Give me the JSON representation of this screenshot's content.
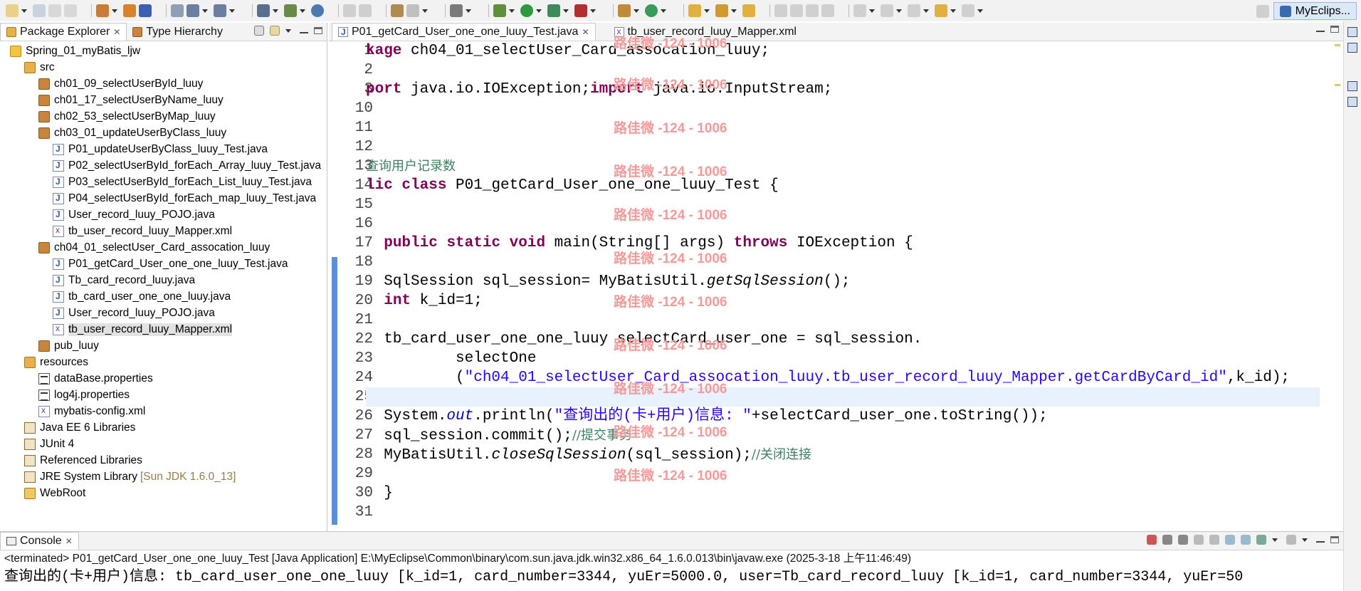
{
  "window": {
    "perspective": "MyEclips..."
  },
  "package_explorer": {
    "tabs": [
      {
        "label": "Package Explorer",
        "close": "✕"
      },
      {
        "label": "Type Hierarchy"
      }
    ],
    "tree": [
      {
        "label": "Spring_01_myBatis_ljw",
        "icon": "project-icon",
        "depth": 1
      },
      {
        "label": "src",
        "icon": "source-folder-icon",
        "depth": 2
      },
      {
        "label": "ch01_09_selectUserById_luuy",
        "icon": "package-icon",
        "depth": 3
      },
      {
        "label": "ch01_17_selectUserByName_luuy",
        "icon": "package-icon",
        "depth": 3
      },
      {
        "label": "ch02_53_selectUserByMap_luuy",
        "icon": "package-icon",
        "depth": 3
      },
      {
        "label": "ch03_01_updateUserByClass_luuy",
        "icon": "package-icon",
        "depth": 3
      },
      {
        "label": "P01_updateUserByClass_luuy_Test.java",
        "icon": "java-file-icon",
        "depth": 4
      },
      {
        "label": "P02_selectUserById_forEach_Array_luuy_Test.java",
        "icon": "java-file-icon",
        "depth": 4
      },
      {
        "label": "P03_selectUserById_forEach_List_luuy_Test.java",
        "icon": "java-file-icon",
        "depth": 4
      },
      {
        "label": "P04_selectUserById_forEach_map_luuy_Test.java",
        "icon": "java-file-icon",
        "depth": 4
      },
      {
        "label": "User_record_luuy_POJO.java",
        "icon": "java-file-icon",
        "depth": 4
      },
      {
        "label": "tb_user_record_luuy_Mapper.xml",
        "icon": "xml-file-icon",
        "depth": 4
      },
      {
        "label": "ch04_01_selectUser_Card_assocation_luuy",
        "icon": "package-icon",
        "depth": 3
      },
      {
        "label": "P01_getCard_User_one_one_luuy_Test.java",
        "icon": "java-file-icon",
        "depth": 4
      },
      {
        "label": "Tb_card_record_luuy.java",
        "icon": "java-file-icon",
        "depth": 4
      },
      {
        "label": "tb_card_user_one_one_luuy.java",
        "icon": "java-file-icon",
        "depth": 4
      },
      {
        "label": "User_record_luuy_POJO.java",
        "icon": "java-file-icon",
        "depth": 4
      },
      {
        "label": "tb_user_record_luuy_Mapper.xml",
        "icon": "xml-file-icon",
        "depth": 4,
        "selected": true
      },
      {
        "label": "pub_luuy",
        "icon": "package-icon",
        "depth": 3
      },
      {
        "label": "resources",
        "icon": "source-folder-icon",
        "depth": 2
      },
      {
        "label": "dataBase.properties",
        "icon": "properties-file-icon",
        "depth": 3
      },
      {
        "label": "log4j.properties",
        "icon": "properties-file-icon",
        "depth": 3
      },
      {
        "label": "mybatis-config.xml",
        "icon": "xml-file-icon",
        "depth": 3
      },
      {
        "label": "Java EE 6 Libraries",
        "icon": "library-icon",
        "depth": 2
      },
      {
        "label": "JUnit 4",
        "icon": "library-icon",
        "depth": 2
      },
      {
        "label": "Referenced Libraries",
        "icon": "library-icon",
        "depth": 2
      },
      {
        "label": "JRE System Library",
        "suffix": "[Sun JDK 1.6.0_13]",
        "icon": "library-icon",
        "depth": 2
      },
      {
        "label": "WebRoot",
        "icon": "folder-icon",
        "depth": 2
      }
    ]
  },
  "editor": {
    "tabs": [
      {
        "label": "P01_getCard_User_one_one_luuy_Test.java",
        "close": "✕",
        "active": true
      },
      {
        "label": "tb_user_record_luuy_Mapper.xml",
        "active": false
      }
    ],
    "line_numbers": [
      "1",
      "2",
      "3",
      "10",
      "11",
      "12",
      "13",
      "14",
      "15",
      "16",
      "17",
      "18",
      "19",
      "20",
      "21",
      "22",
      "23",
      "24",
      "25",
      "26",
      "27",
      "28",
      "29",
      "30",
      "31"
    ],
    "lines": [
      [
        {
          "t": "kage ",
          "c": "kw"
        },
        {
          "t": "ch04_01_selectUser_Card_assocation_luuy;"
        }
      ],
      [],
      [
        {
          "t": "port ",
          "c": "kw"
        },
        {
          "t": "java.io.IOException;"
        },
        {
          "t": "import ",
          "c": "kw"
        },
        {
          "t": "java.io.InputStream;"
        }
      ],
      [],
      [],
      [],
      [
        {
          "t": "查询用户记录数",
          "c": "cmt"
        }
      ],
      [
        {
          "t": "lic ",
          "c": "kw"
        },
        {
          "t": "class ",
          "c": "kw"
        },
        {
          "t": "P01_getCard_User_one_one_luuy_Test {"
        }
      ],
      [],
      [],
      [
        {
          "t": "  "
        },
        {
          "t": "public ",
          "c": "kw"
        },
        {
          "t": "static ",
          "c": "kw"
        },
        {
          "t": "void ",
          "c": "kw"
        },
        {
          "t": "main(String[] args) "
        },
        {
          "t": "throws ",
          "c": "kw"
        },
        {
          "t": "IOException {"
        }
      ],
      [],
      [
        {
          "t": "  SqlSession sql_session= MyBatisUtil."
        },
        {
          "t": "getSqlSession",
          "c": "it"
        },
        {
          "t": "();"
        }
      ],
      [
        {
          "t": "  "
        },
        {
          "t": "int ",
          "c": "kw"
        },
        {
          "t": "k_id=1;"
        }
      ],
      [],
      [
        {
          "t": "  tb_card_user_one_one_luuy selectCard_user_one = sql_session."
        }
      ],
      [
        {
          "t": "          selectOne"
        }
      ],
      [
        {
          "t": "          ("
        },
        {
          "t": "\"ch04_01_selectUser_Card_assocation_luuy.tb_user_record_luuy_Mapper.getCardByCard_id\"",
          "c": "str"
        },
        {
          "t": ",k_id);"
        }
      ],
      [],
      [
        {
          "t": "  System."
        },
        {
          "t": "out",
          "c": "fld"
        },
        {
          "t": ".println("
        },
        {
          "t": "\"查询出的(卡+用户)信息: \"",
          "c": "str"
        },
        {
          "t": "+selectCard_user_one.toString());"
        }
      ],
      [
        {
          "t": "  sql_session.commit();"
        },
        {
          "t": "//提交事务",
          "c": "cmt"
        }
      ],
      [
        {
          "t": "  MyBatisUtil."
        },
        {
          "t": "closeSqlSession",
          "c": "it"
        },
        {
          "t": "(sql_session);"
        },
        {
          "t": "//关闭连接",
          "c": "cmt"
        }
      ],
      [],
      [
        {
          "t": "  }"
        }
      ],
      []
    ],
    "current_line_index": 18,
    "watermark": "路佳微 -124 - 1006"
  },
  "console": {
    "tab": "Console",
    "close": "✕",
    "status": "<terminated> P01_getCard_User_one_one_luuy_Test [Java Application] E:\\MyEclipse\\Common\\binary\\com.sun.java.jdk.win32.x86_64_1.6.0.013\\bin\\javaw.exe (2025-3-18 上午11:46:49)",
    "output": "查询出的(卡+用户)信息: tb_card_user_one_one_luuy [k_id=1, card_number=3344, yuEr=5000.0, user=Tb_card_record_luuy [k_id=1, card_number=3344, yuEr=50"
  },
  "colors": {
    "keyword": "#7f0055",
    "string": "#2a00ff",
    "comment": "#3f7f5f",
    "current_line": "#e8f2fe",
    "watermark": "#f39a9a"
  }
}
